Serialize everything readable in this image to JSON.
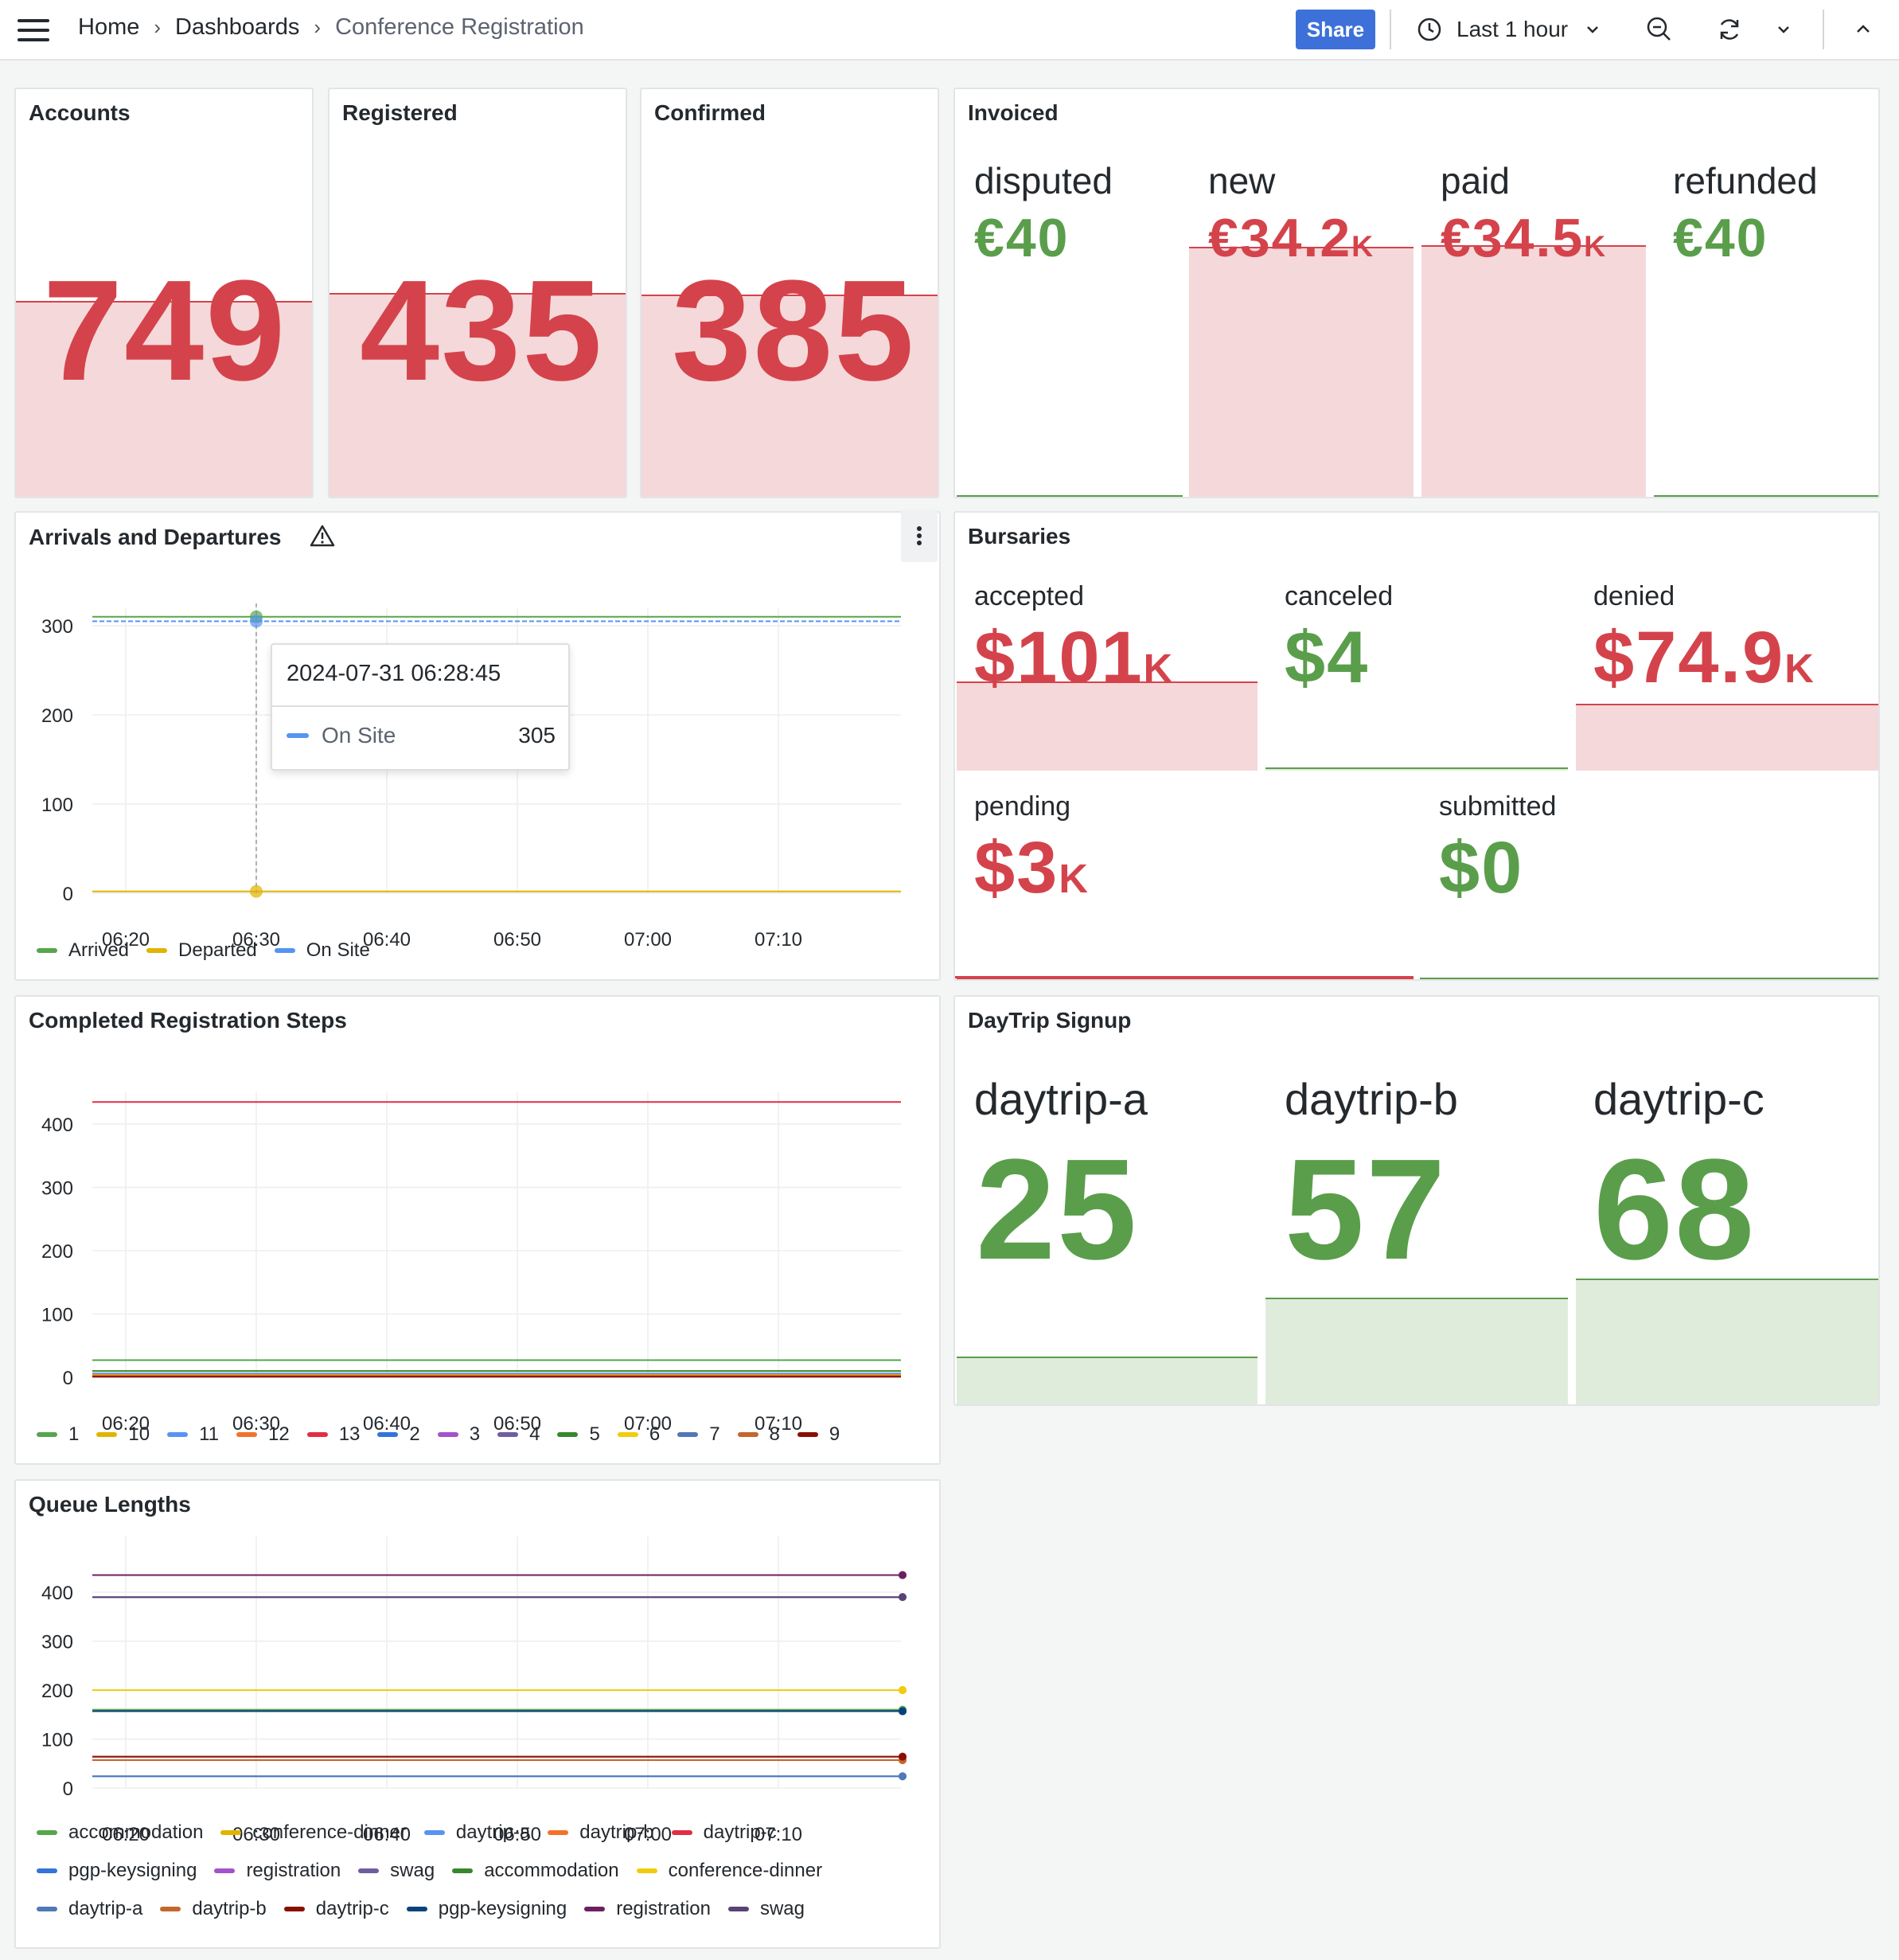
{
  "breadcrumb": {
    "home": "Home",
    "dashboards": "Dashboards",
    "current": "Conference Registration",
    "sep": "›"
  },
  "toolbar": {
    "share": "Share",
    "time_range": "Last 1 hour"
  },
  "stats": {
    "accounts": {
      "title": "Accounts",
      "value": "749"
    },
    "registered": {
      "title": "Registered",
      "value": "435"
    },
    "confirmed": {
      "title": "Confirmed",
      "value": "385"
    }
  },
  "invoiced": {
    "title": "Invoiced",
    "items": [
      {
        "name": "disputed",
        "value": "€40",
        "unit": ""
      },
      {
        "name": "new",
        "value": "€34.2",
        "unit": "K"
      },
      {
        "name": "paid",
        "value": "€34.5",
        "unit": "K"
      },
      {
        "name": "refunded",
        "value": "€40",
        "unit": ""
      }
    ]
  },
  "bursaries": {
    "title": "Bursaries",
    "items": [
      {
        "name": "accepted",
        "value": "$101",
        "unit": "K"
      },
      {
        "name": "canceled",
        "value": "$4",
        "unit": ""
      },
      {
        "name": "denied",
        "value": "$74.9",
        "unit": "K"
      },
      {
        "name": "pending",
        "value": "$3",
        "unit": "K"
      },
      {
        "name": "submitted",
        "value": "$0",
        "unit": ""
      }
    ]
  },
  "daytrip": {
    "title": "DayTrip Signup",
    "items": [
      {
        "name": "daytrip-a",
        "value": "25"
      },
      {
        "name": "daytrip-b",
        "value": "57"
      },
      {
        "name": "daytrip-c",
        "value": "68"
      }
    ]
  },
  "arrivals": {
    "title": "Arrivals and Departures",
    "tooltip": {
      "time": "2024-07-31 06:28:45",
      "series": "On Site",
      "value": "305"
    }
  },
  "colors": {
    "red": "#d4434b",
    "green": "#5a9e4b",
    "red_bg": "#f5d8da",
    "green_bg": "#e0ecdb"
  },
  "chart_data": [
    {
      "type": "line",
      "title": "Arrivals and Departures",
      "x": [
        "06:20",
        "06:30",
        "06:40",
        "06:50",
        "07:00",
        "07:10"
      ],
      "ylim": [
        0,
        300
      ],
      "yticks": [
        0,
        100,
        200,
        300
      ],
      "series": [
        {
          "name": "Arrived",
          "color": "#56a64b",
          "values": [
            310,
            310,
            310,
            310,
            310,
            310
          ]
        },
        {
          "name": "Departed",
          "color": "#e0b400",
          "values": [
            2,
            2,
            2,
            2,
            2,
            2
          ]
        },
        {
          "name": "On Site",
          "color": "#5794f2",
          "values": [
            305,
            305,
            305,
            305,
            305,
            305
          ]
        }
      ]
    },
    {
      "type": "line",
      "title": "Completed Registration Steps",
      "x": [
        "06:20",
        "06:30",
        "06:40",
        "06:50",
        "07:00",
        "07:10"
      ],
      "ylim": [
        0,
        400
      ],
      "yticks": [
        0,
        100,
        200,
        300,
        400
      ],
      "series": [
        {
          "name": "1",
          "color": "#56a64b",
          "values": [
            27,
            27,
            27,
            27,
            27,
            27
          ]
        },
        {
          "name": "10",
          "color": "#e0b400",
          "values": [
            5,
            5,
            5,
            5,
            5,
            5
          ]
        },
        {
          "name": "11",
          "color": "#5794f2",
          "values": [
            6,
            6,
            6,
            6,
            6,
            6
          ]
        },
        {
          "name": "12",
          "color": "#f2722b",
          "values": [
            4,
            4,
            4,
            4,
            4,
            4
          ]
        },
        {
          "name": "13",
          "color": "#e02f44",
          "values": [
            435,
            435,
            435,
            435,
            435,
            435
          ]
        },
        {
          "name": "2",
          "color": "#3274d9",
          "values": [
            3,
            3,
            3,
            3,
            3,
            3
          ]
        },
        {
          "name": "3",
          "color": "#a352cc",
          "values": [
            2,
            2,
            2,
            2,
            2,
            2
          ]
        },
        {
          "name": "4",
          "color": "#705da0",
          "values": [
            2,
            2,
            2,
            2,
            2,
            2
          ]
        },
        {
          "name": "5",
          "color": "#37872d",
          "values": [
            10,
            10,
            10,
            10,
            10,
            10
          ]
        },
        {
          "name": "6",
          "color": "#f2cc0c",
          "values": [
            3,
            3,
            3,
            3,
            3,
            3
          ]
        },
        {
          "name": "7",
          "color": "#5178b8",
          "values": [
            1,
            1,
            1,
            1,
            1,
            1
          ]
        },
        {
          "name": "8",
          "color": "#c4662e",
          "values": [
            2,
            2,
            2,
            2,
            2,
            2
          ]
        },
        {
          "name": "9",
          "color": "#890f02",
          "values": [
            1,
            1,
            1,
            1,
            1,
            1
          ]
        }
      ]
    },
    {
      "type": "line",
      "title": "Queue Lengths",
      "x": [
        "06:20",
        "06:30",
        "06:40",
        "06:50",
        "07:00",
        "07:10"
      ],
      "ylim": [
        0,
        400
      ],
      "yticks": [
        0,
        100,
        200,
        300,
        400
      ],
      "series": [
        {
          "name": "accommodation",
          "color": "#56a64b",
          "values": [
            160,
            160,
            160,
            160,
            160,
            160
          ]
        },
        {
          "name": "conference-dinner",
          "color": "#e0b400",
          "values": [
            200,
            200,
            200,
            200,
            200,
            200
          ]
        },
        {
          "name": "daytrip-a",
          "color": "#5794f2",
          "values": [
            24,
            24,
            24,
            24,
            24,
            24
          ]
        },
        {
          "name": "daytrip-b",
          "color": "#f2722b",
          "values": [
            57,
            57,
            57,
            57,
            57,
            57
          ]
        },
        {
          "name": "daytrip-c",
          "color": "#e02f44",
          "values": [
            64,
            64,
            64,
            64,
            64,
            64
          ]
        },
        {
          "name": "pgp-keysigning",
          "color": "#3274d9",
          "values": [
            157,
            157,
            157,
            157,
            157,
            157
          ]
        },
        {
          "name": "registration",
          "color": "#a352cc",
          "values": [
            435,
            435,
            435,
            435,
            435,
            435
          ]
        },
        {
          "name": "swag",
          "color": "#705da0",
          "values": [
            390,
            390,
            390,
            390,
            390,
            390
          ]
        },
        {
          "name": "accommodation",
          "color": "#37872d",
          "values": [
            157,
            157,
            157,
            157,
            157,
            157
          ]
        },
        {
          "name": "conference-dinner",
          "color": "#f2cc0c",
          "values": [
            200,
            200,
            200,
            200,
            200,
            200
          ]
        },
        {
          "name": "daytrip-a",
          "color": "#5178b8",
          "values": [
            24,
            24,
            24,
            24,
            24,
            24
          ]
        },
        {
          "name": "daytrip-b",
          "color": "#c4662e",
          "values": [
            57,
            57,
            57,
            57,
            57,
            57
          ]
        },
        {
          "name": "daytrip-c",
          "color": "#890f02",
          "values": [
            64,
            64,
            64,
            64,
            64,
            64
          ]
        },
        {
          "name": "pgp-keysigning",
          "color": "#0a437c",
          "values": [
            157,
            157,
            157,
            157,
            157,
            157
          ]
        },
        {
          "name": "registration",
          "color": "#6d1f62",
          "values": [
            435,
            435,
            435,
            435,
            435,
            435
          ]
        },
        {
          "name": "swag",
          "color": "#584477",
          "values": [
            390,
            390,
            390,
            390,
            390,
            390
          ]
        }
      ]
    }
  ]
}
